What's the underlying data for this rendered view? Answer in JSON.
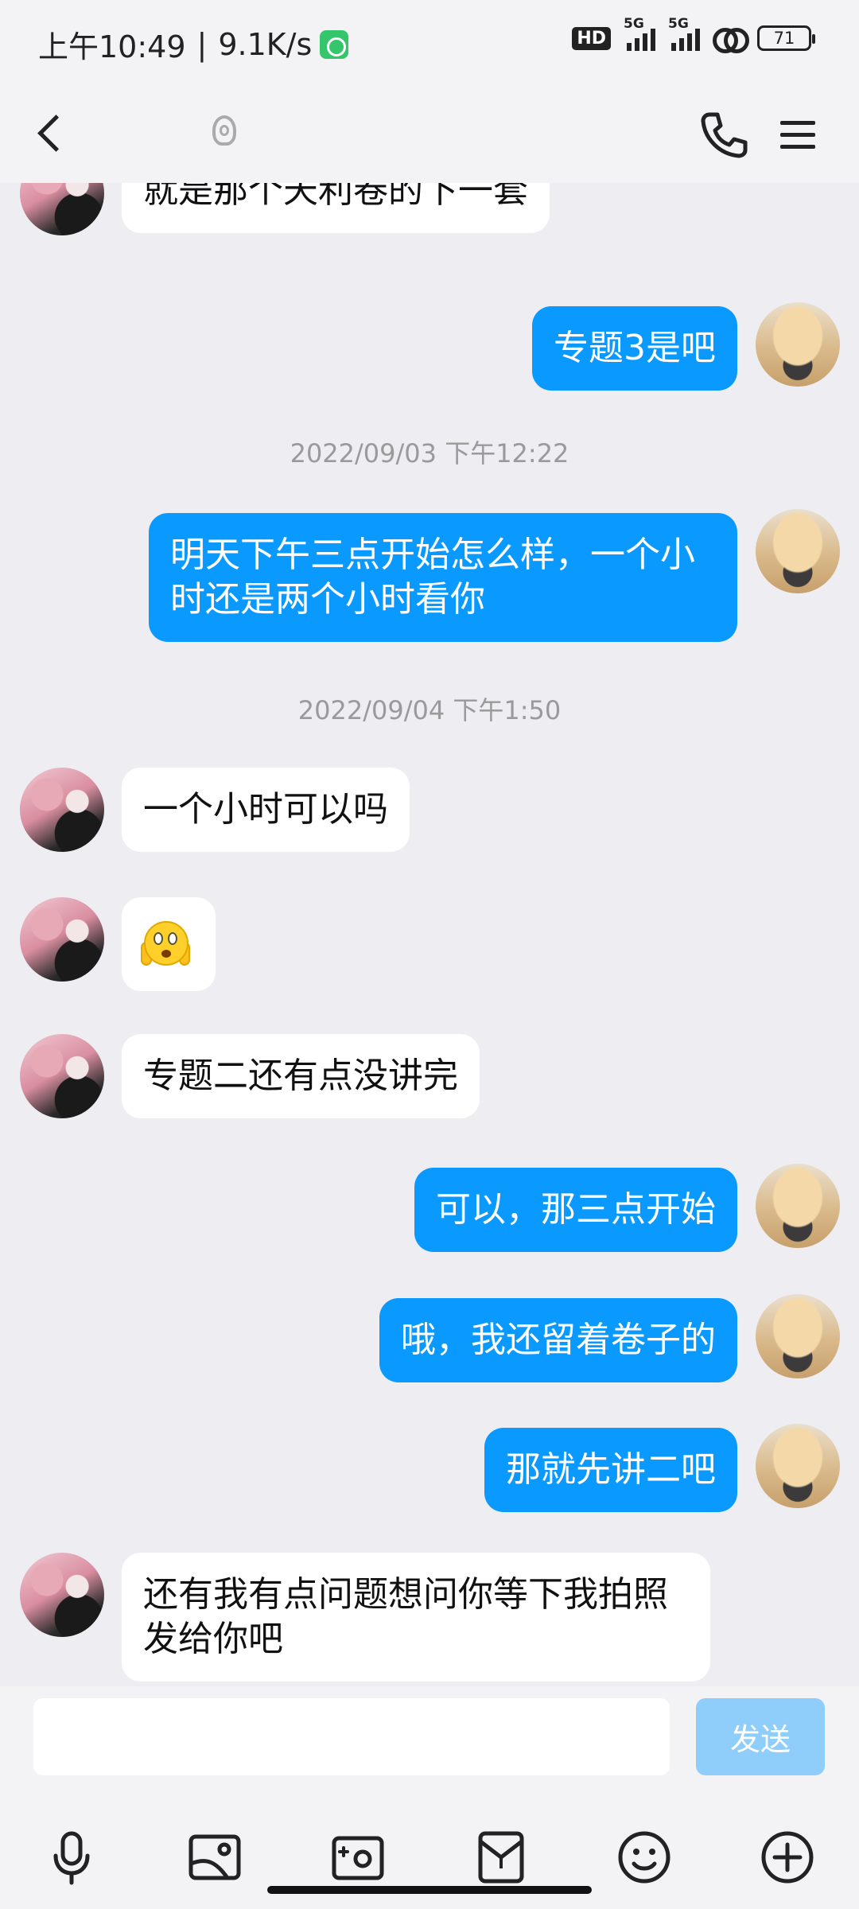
{
  "status_bar": {
    "time": "上午10:49",
    "net_speed": "9.1K/s",
    "hd_label": "HD",
    "network_1": "5G",
    "network_2": "5G",
    "battery": "71"
  },
  "nav": {
    "contact_name": "",
    "icons": [
      "back-icon",
      "ear-icon",
      "phone-icon",
      "menu-icon"
    ]
  },
  "messages": [
    {
      "side": "peer",
      "text": "就是那个天利卷的下一套"
    },
    {
      "side": "self",
      "text": "专题3是吧"
    },
    {
      "type": "time",
      "text": "2022/09/03 下午12:22"
    },
    {
      "side": "self",
      "text": "明天下午三点开始怎么样，一个小\n时还是两个小时看你"
    },
    {
      "type": "time",
      "text": "2022/09/04 下午1:50"
    },
    {
      "side": "peer",
      "text": "一个小时可以吗"
    },
    {
      "side": "peer",
      "type": "emoji",
      "emoji": "face-with-open-eyes-and-hand-over-mouth"
    },
    {
      "side": "peer",
      "text": "专题二还有点没讲完"
    },
    {
      "side": "self",
      "text": "可以，那三点开始"
    },
    {
      "side": "self",
      "text": "哦，我还留着卷子的"
    },
    {
      "side": "self",
      "text": "那就先讲二吧"
    },
    {
      "side": "peer",
      "text": "还有我有点问题想问你等下我拍照\n发给你吧"
    }
  ],
  "input": {
    "value": "",
    "placeholder": "",
    "send_label": "发送"
  },
  "toolbar": [
    "microphone-icon",
    "image-icon",
    "camera-icon",
    "red-packet-icon",
    "emoji-icon",
    "plus-icon"
  ],
  "colors": {
    "self_bubble": "#0a99ff",
    "peer_bubble": "#ffffff",
    "background": "#ededf2",
    "send_disabled": "#8fcdfa"
  }
}
